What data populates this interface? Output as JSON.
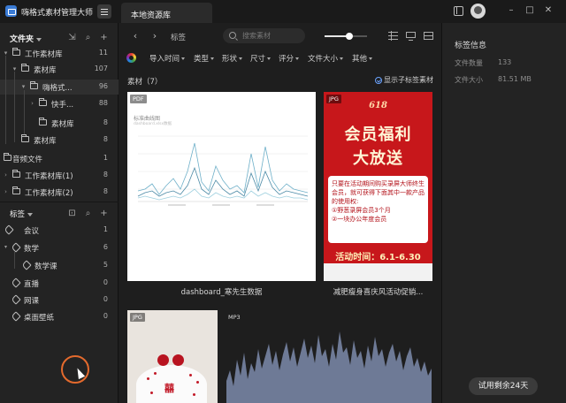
{
  "app": {
    "title": "嗨格式素材管理大师"
  },
  "tabs": [
    {
      "label": "本地资源库"
    }
  ],
  "folders_panel": {
    "title": "文件夹",
    "items": [
      {
        "label": "工作素材库",
        "count": "11"
      },
      {
        "label": "素材库",
        "count": "107"
      },
      {
        "label": "嗨格式...",
        "count": "96"
      },
      {
        "label": "快手...",
        "count": "88"
      },
      {
        "label": "素材库",
        "count": "8"
      },
      {
        "label": "素材库",
        "count": "8"
      },
      {
        "label": "音频文件",
        "count": "1"
      },
      {
        "label": "工作素材库(1)",
        "count": "8"
      },
      {
        "label": "工作素材库(2)",
        "count": "8"
      }
    ]
  },
  "tags_panel": {
    "title": "标签",
    "items": [
      {
        "label": "会议",
        "count": "1"
      },
      {
        "label": "数学",
        "count": "6"
      },
      {
        "label": "数学课",
        "count": "5"
      },
      {
        "label": "直播",
        "count": "0"
      },
      {
        "label": "网课",
        "count": "0"
      },
      {
        "label": "桌面壁纸",
        "count": "0"
      }
    ]
  },
  "toolbar": {
    "breadcrumb": "标签",
    "search_placeholder": "搜索素材",
    "zoom_level": 0.58
  },
  "filters": [
    "导入时间",
    "类型",
    "形状",
    "尺寸",
    "评分",
    "文件大小",
    "其他"
  ],
  "assets": {
    "label": "素材（7）",
    "show_subtags": "显示子标签素材",
    "cards": [
      {
        "badge": "PDF",
        "caption": "dashboard_寒先生数据",
        "chart_title": "标准曲线图",
        "chart_sub": "dashboard.xlsx数据"
      },
      {
        "badge": "JPG",
        "caption": "减肥瘦身喜庆风活动促销...",
        "promo": {
          "num": "618",
          "line1": "会员福利",
          "line2": "大放送",
          "body": "只要在活动期间购买录屏大师终生会员，就可获得下面其中一款产品的使用权:",
          "item1": "①野葱录屏会员3个月",
          "item2": "②一块办公年度会员",
          "date": "活动时间：6.1-6.30"
        }
      },
      {
        "badge": "JPG",
        "caption": "",
        "cake_char": "囍"
      },
      {
        "badge": "MP3",
        "caption": ""
      }
    ]
  },
  "info_panel": {
    "title": "标签信息",
    "rows": [
      {
        "label": "文件数量",
        "value": "133"
      },
      {
        "label": "文件大小",
        "value": "81.51 MB"
      }
    ],
    "trial": "试用剩余24天"
  },
  "colors": {
    "accent": "#6aa3ff",
    "promo_red": "#c7171b",
    "cursor_ring": "#e46a2d"
  },
  "icons": [
    "app-logo-icon",
    "menu-icon",
    "sidebar-toggle-icon",
    "avatar",
    "minimize-icon",
    "maximize-icon",
    "close-icon",
    "back-icon",
    "forward-icon",
    "search-icon",
    "grid-view-icon",
    "monitor-icon",
    "layout-icon",
    "color-filter-icon",
    "folder-icon",
    "tag-icon",
    "add-icon"
  ]
}
